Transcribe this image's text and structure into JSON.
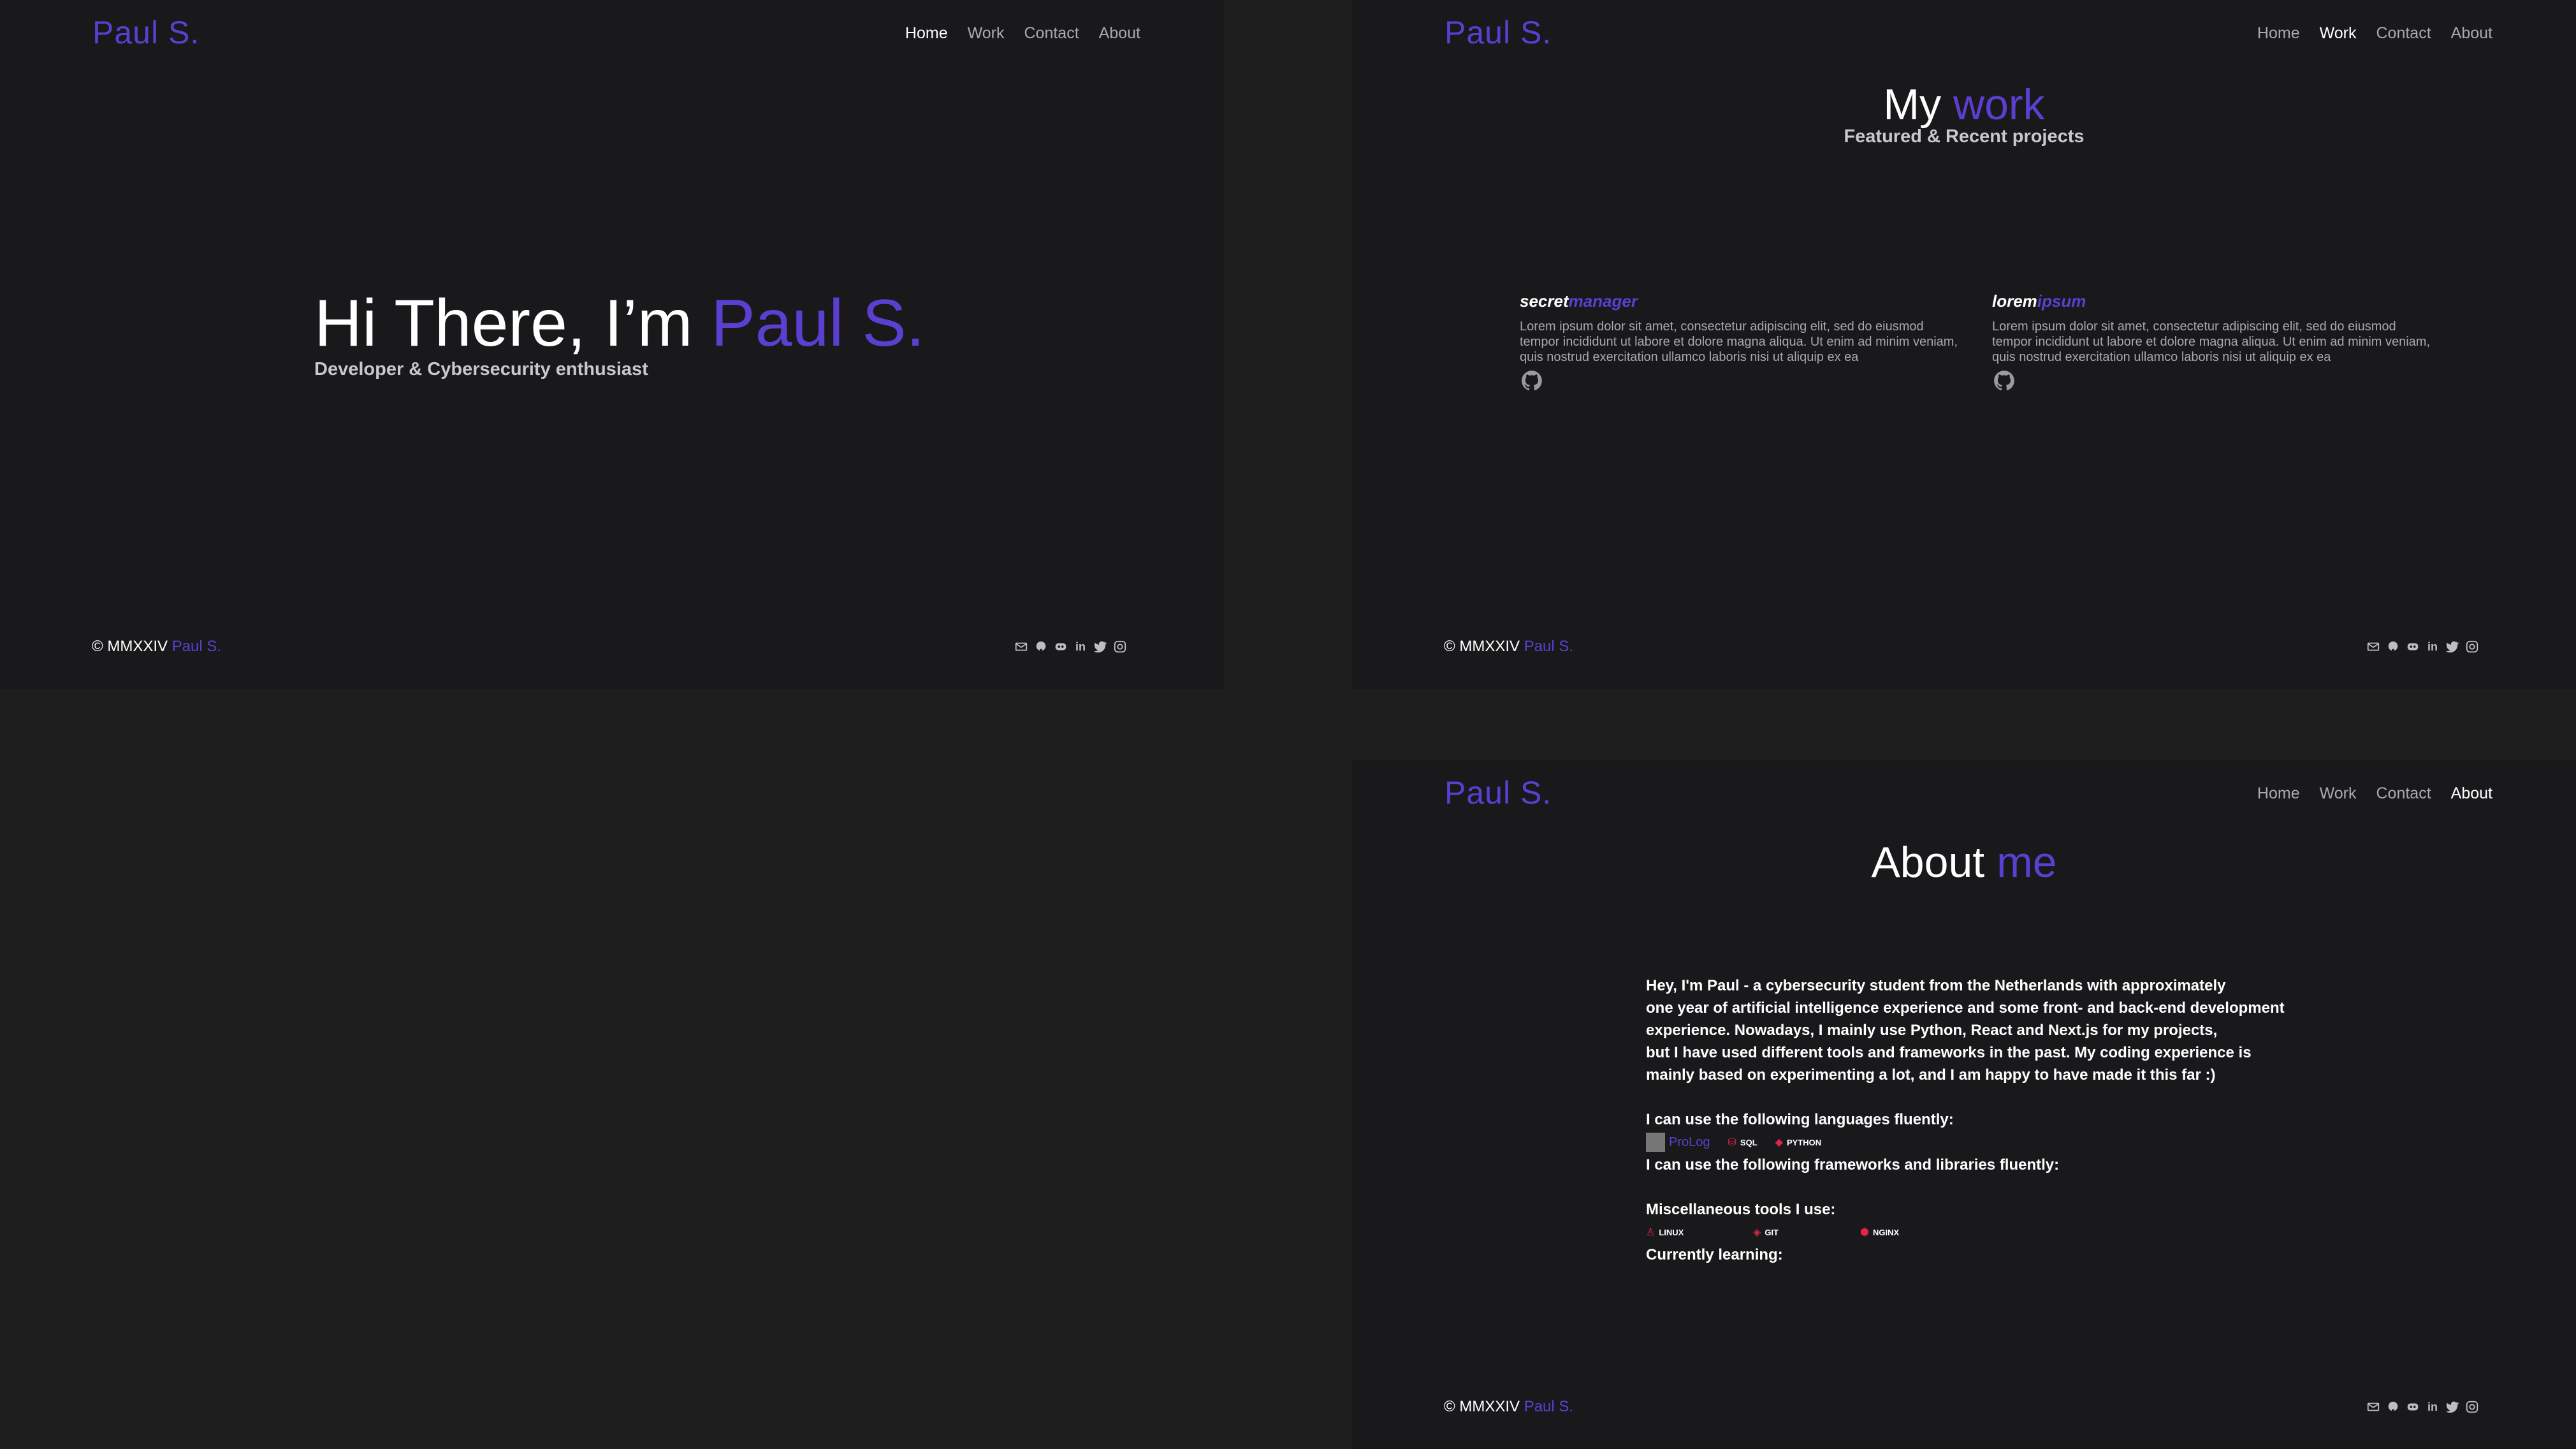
{
  "brand": "Paul S.",
  "nav": {
    "home": "Home",
    "work": "Work",
    "contact": "Contact",
    "about": "About"
  },
  "footer": {
    "copyright": "© MMXXIV",
    "name": "Paul S."
  },
  "social_icons": [
    "mail-icon",
    "github-icon",
    "discord-icon",
    "linkedin-icon",
    "twitter-icon",
    "instagram-icon"
  ],
  "colors": {
    "accent": "#5b3fd0",
    "background": "#19191b",
    "badge_red": "#e0244a"
  },
  "home": {
    "hero_prefix": "Hi There, I’m",
    "hero_name": "Paul S.",
    "subtitle": "Developer & Cybersecurity enthusiast"
  },
  "work": {
    "title_prefix": "My",
    "title_accent": "work",
    "subtitle": "Featured & Recent projects",
    "projects": [
      {
        "title_a": "secret",
        "title_b": "manager",
        "description": "Lorem ipsum dolor sit amet, consectetur adipiscing elit, sed do eiusmod  tempor incididunt ut labore et dolore magna aliqua. Ut enim ad minim  veniam, quis nostrud exercitation ullamco laboris nisi ut aliquip ex ea"
      },
      {
        "title_a": "lorem",
        "title_b": "ipsum",
        "description": "Lorem ipsum dolor sit amet, consectetur adipiscing elit, sed do eiusmod  tempor incididunt ut labore et dolore magna aliqua. Ut enim ad minim  veniam, quis nostrud exercitation ullamco laboris nisi ut aliquip ex ea"
      }
    ]
  },
  "about": {
    "title_prefix": "About",
    "title_accent": "me",
    "bio": [
      "Hey, I'm Paul - a cybersecurity student from the Netherlands with approximately",
      "one year of artificial intelligence experience and some front- and back-end development",
      "experience. Nowadays, I mainly use Python, React and Next.js for my projects,",
      "but I have used different tools and frameworks in the past. My coding experience is",
      "mainly based on experimenting a lot, and I am happy to have made it this far :)"
    ],
    "languages_heading": "I can use the following languages fluently:",
    "languages": [
      "ProLog",
      "SQL",
      "PYTHON"
    ],
    "frameworks_heading": "I can use the following frameworks and libraries fluently:",
    "tools_heading": "Miscellaneous tools I use:",
    "tools": [
      "LINUX",
      "GIT",
      "NGINX"
    ],
    "learning_heading": "Currently learning:"
  }
}
